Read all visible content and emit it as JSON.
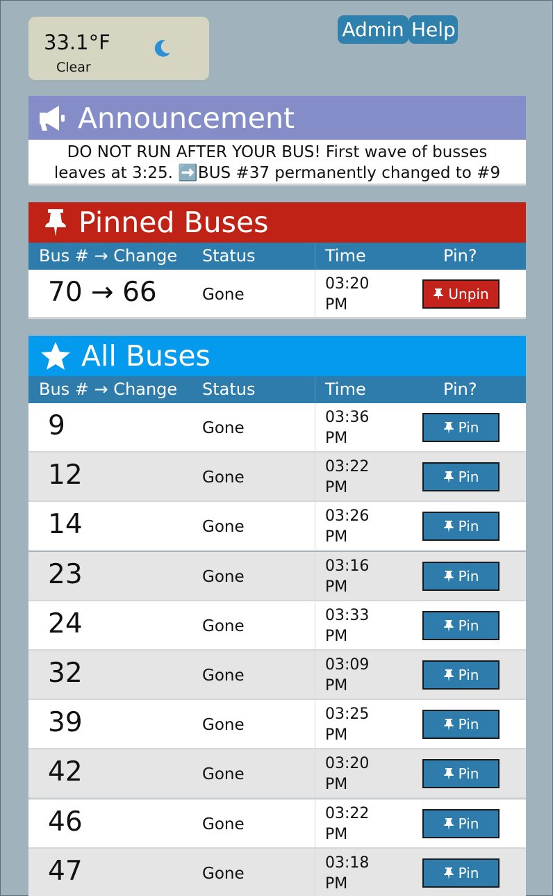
{
  "weather": {
    "temperature": "33.1°F",
    "condition": "Clear",
    "icon": "moon-icon"
  },
  "nav": {
    "admin_label": "Admin",
    "help_label": "Help"
  },
  "announcement": {
    "title": "Announcement",
    "icon": "megaphone-icon",
    "line1": "DO NOT RUN AFTER YOUR BUS! First wave of busses",
    "line2": "leaves at 3:25. ➡️BUS #37 permanently changed to #9"
  },
  "columns": {
    "bus": "Bus # → Change",
    "status": "Status",
    "time": "Time",
    "pin": "Pin?"
  },
  "pinned": {
    "title": "Pinned Buses",
    "icon": "pushpin-icon",
    "rows": [
      {
        "bus": "70 → 66",
        "status": "Gone",
        "time_h": "03:20",
        "time_ap": "PM",
        "action": "Unpin"
      }
    ]
  },
  "all": {
    "title": "All Buses",
    "icon": "star-icon",
    "rows": [
      {
        "bus": "9",
        "status": "Gone",
        "time_h": "03:36",
        "time_ap": "PM",
        "action": "Pin"
      },
      {
        "bus": "12",
        "status": "Gone",
        "time_h": "03:22",
        "time_ap": "PM",
        "action": "Pin"
      },
      {
        "bus": "14",
        "status": "Gone",
        "time_h": "03:26",
        "time_ap": "PM",
        "action": "Pin"
      },
      {
        "bus": "23",
        "status": "Gone",
        "time_h": "03:16",
        "time_ap": "PM",
        "action": "Pin"
      },
      {
        "bus": "24",
        "status": "Gone",
        "time_h": "03:33",
        "time_ap": "PM",
        "action": "Pin"
      },
      {
        "bus": "32",
        "status": "Gone",
        "time_h": "03:09",
        "time_ap": "PM",
        "action": "Pin"
      },
      {
        "bus": "39",
        "status": "Gone",
        "time_h": "03:25",
        "time_ap": "PM",
        "action": "Pin"
      },
      {
        "bus": "42",
        "status": "Gone",
        "time_h": "03:20",
        "time_ap": "PM",
        "action": "Pin"
      },
      {
        "bus": "46",
        "status": "Gone",
        "time_h": "03:22",
        "time_ap": "PM",
        "action": "Pin"
      },
      {
        "bus": "47",
        "status": "Gone",
        "time_h": "03:18",
        "time_ap": "PM",
        "action": "Pin"
      }
    ]
  },
  "colors": {
    "background": "#a0b3bd",
    "nav": "#2f81ad",
    "announcement": "#848dc7",
    "pinned": "#c02216",
    "all": "#049bef",
    "table_header": "#2e7cab",
    "unpin": "#c3231b"
  }
}
